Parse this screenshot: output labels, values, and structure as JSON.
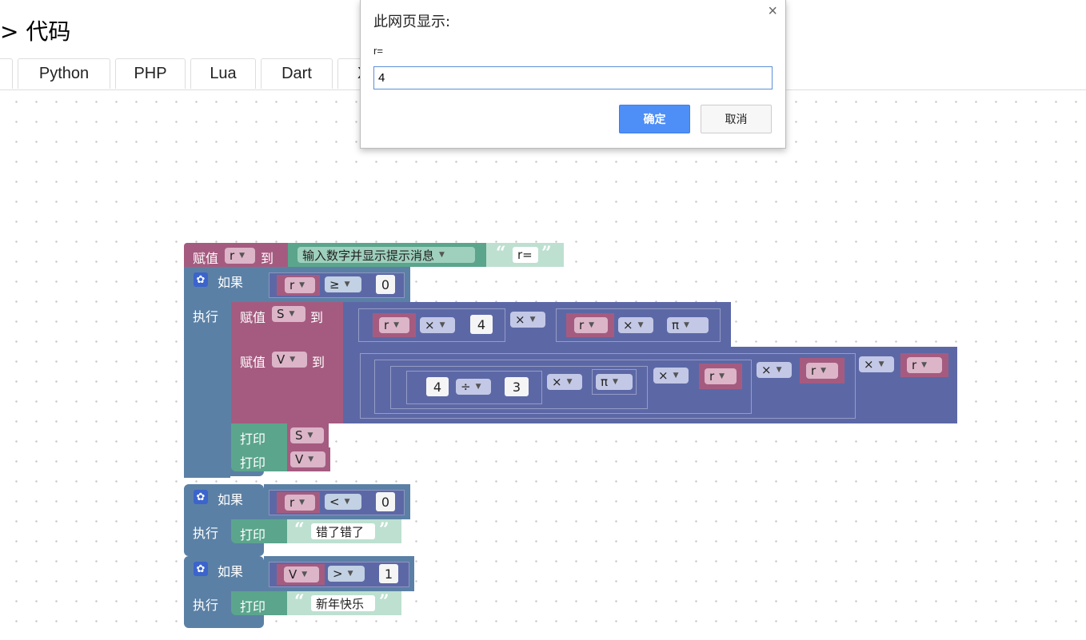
{
  "header": {
    "title": "> 代码"
  },
  "tabs": [
    {
      "label": "Python"
    },
    {
      "label": "PHP"
    },
    {
      "label": "Lua"
    },
    {
      "label": "Dart"
    },
    {
      "label": "X"
    }
  ],
  "blocks": {
    "set_label": "赋值",
    "to_label": "到",
    "if_label": "如果",
    "do_label": "执行",
    "print_label": "打印",
    "prompt_type": "输入数字并显示提示消息",
    "prompt_text": "r=",
    "var_r": "r",
    "var_S": "S",
    "var_V": "V",
    "op_gte": "≥",
    "op_lt": "<",
    "op_gt": ">",
    "op_mul": "×",
    "op_div": "÷",
    "pi": "π",
    "num_0": "0",
    "num_4": "4",
    "num_3": "3",
    "num_1": "1",
    "text_error": "错了错了",
    "text_happy": "新年快乐",
    "quote_open": "“",
    "quote_close": "”"
  },
  "dialog": {
    "title": "此网页显示:",
    "message": "r=",
    "input_value": "4",
    "ok_label": "确定",
    "cancel_label": "取消",
    "close_glyph": "×"
  },
  "colors": {
    "variables": "#a55b80",
    "logic": "#5b80a5",
    "math": "#5c68a6",
    "text": "#5ba58c",
    "dialog_ok": "#4e8ef7"
  }
}
